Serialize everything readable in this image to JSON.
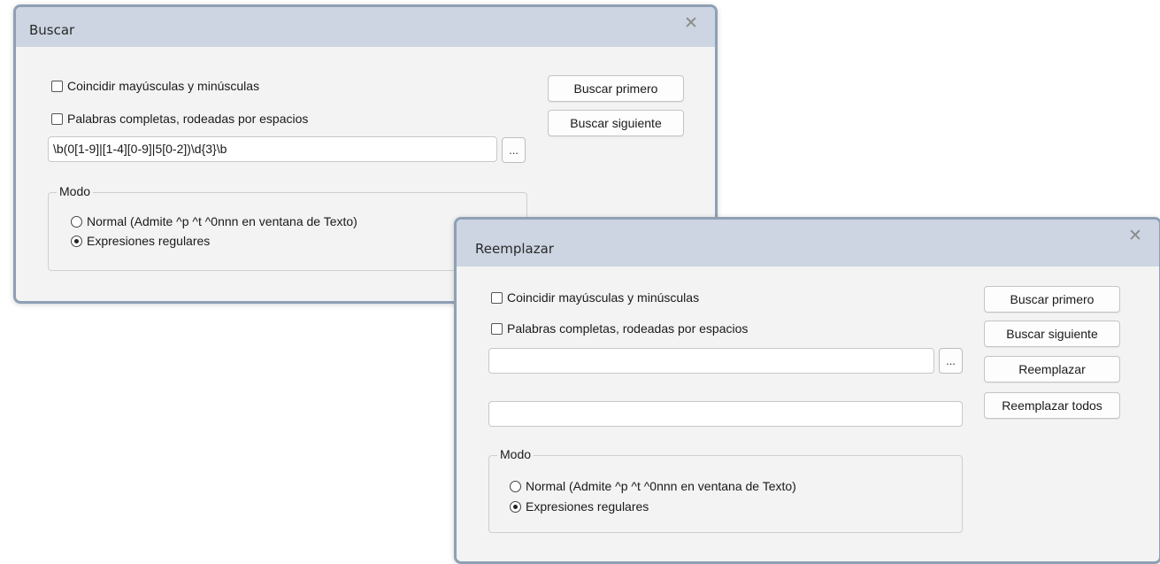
{
  "find_dialog": {
    "title": "Buscar",
    "close_glyph": "✕",
    "match_case_label": "Coincidir mayúsculas y minúsculas",
    "match_case_checked": false,
    "whole_words_label": "Palabras completas, rodeadas por espacios",
    "whole_words_checked": false,
    "search_value": "\\b(0[1-9]|[1-4][0-9]|5[0-2])\\d{3}\\b",
    "browse_label": "...",
    "find_first_label": "Buscar primero",
    "find_next_label": "Buscar siguiente",
    "mode": {
      "legend": "Modo",
      "normal_label": "Normal (Admite ^p ^t ^0nnn en ventana de Texto)",
      "regex_label": "Expresiones regulares",
      "selected": "regex"
    }
  },
  "replace_dialog": {
    "title": "Reemplazar",
    "close_glyph": "✕",
    "match_case_label": "Coincidir mayúsculas y minúsculas",
    "match_case_checked": false,
    "whole_words_label": "Palabras completas, rodeadas por espacios",
    "whole_words_checked": false,
    "search_value": "",
    "replace_value": "",
    "browse_label": "...",
    "find_first_label": "Buscar primero",
    "find_next_label": "Buscar siguiente",
    "replace_label": "Reemplazar",
    "replace_all_label": "Reemplazar todos",
    "mode": {
      "legend": "Modo",
      "normal_label": "Normal (Admite ^p ^t ^0nnn en ventana de Texto)",
      "regex_label": "Expresiones regulares",
      "selected": "regex"
    }
  },
  "colors": {
    "titlebar": "#ccd5e1",
    "dialog_bg": "#f3f3f3",
    "border": "#8fa0b4"
  }
}
